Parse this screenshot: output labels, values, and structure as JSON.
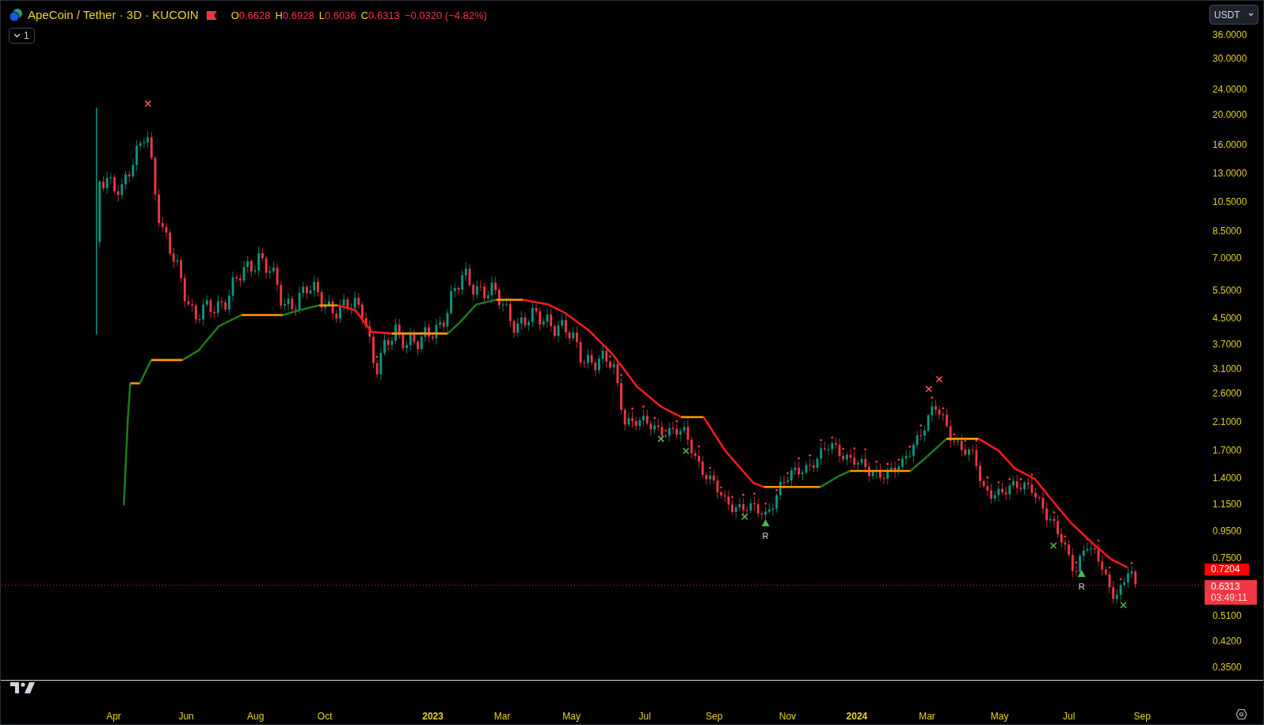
{
  "header": {
    "symbol_title": "ApeCoin / Tether · 3D · KUCOIN",
    "ohlc": [
      {
        "label": "O",
        "value": "0.6628"
      },
      {
        "label": "H",
        "value": "0.6928"
      },
      {
        "label": "L",
        "value": "0.6036"
      },
      {
        "label": "C",
        "value": "0.6313"
      }
    ],
    "change": "−0.0320 (−4.82%)",
    "collapse_button": "1"
  },
  "currency_button": "USDT",
  "price_axis": [
    "36.0000",
    "30.0000",
    "24.0000",
    "20.0000",
    "16.0000",
    "13.0000",
    "10.5000",
    "8.5000",
    "7.0000",
    "5.5000",
    "4.5000",
    "3.7000",
    "3.1000",
    "2.6000",
    "2.1000",
    "1.7000",
    "1.4000",
    "1.1500",
    "0.9500",
    "0.7500",
    "0.5100",
    "0.4200",
    "0.3500"
  ],
  "price_tags": [
    {
      "kind": "indicator",
      "value": "0.7204"
    },
    {
      "kind": "last",
      "value": "0.6313",
      "countdown": "03:49:11"
    }
  ],
  "signal_labels": [
    "R",
    "R"
  ],
  "time_axis": [
    {
      "label": "Apr",
      "kind": "month"
    },
    {
      "label": "Jun",
      "kind": "month"
    },
    {
      "label": "Aug",
      "kind": "month"
    },
    {
      "label": "Oct",
      "kind": "month"
    },
    {
      "label": "2023",
      "kind": "year"
    },
    {
      "label": "Mar",
      "kind": "month"
    },
    {
      "label": "May",
      "kind": "month"
    },
    {
      "label": "Jul",
      "kind": "month"
    },
    {
      "label": "Sep",
      "kind": "month"
    },
    {
      "label": "Nov",
      "kind": "month"
    },
    {
      "label": "2024",
      "kind": "year"
    },
    {
      "label": "Mar",
      "kind": "month"
    },
    {
      "label": "May",
      "kind": "month"
    },
    {
      "label": "Jul",
      "kind": "month"
    },
    {
      "label": "Sep",
      "kind": "month"
    }
  ]
}
